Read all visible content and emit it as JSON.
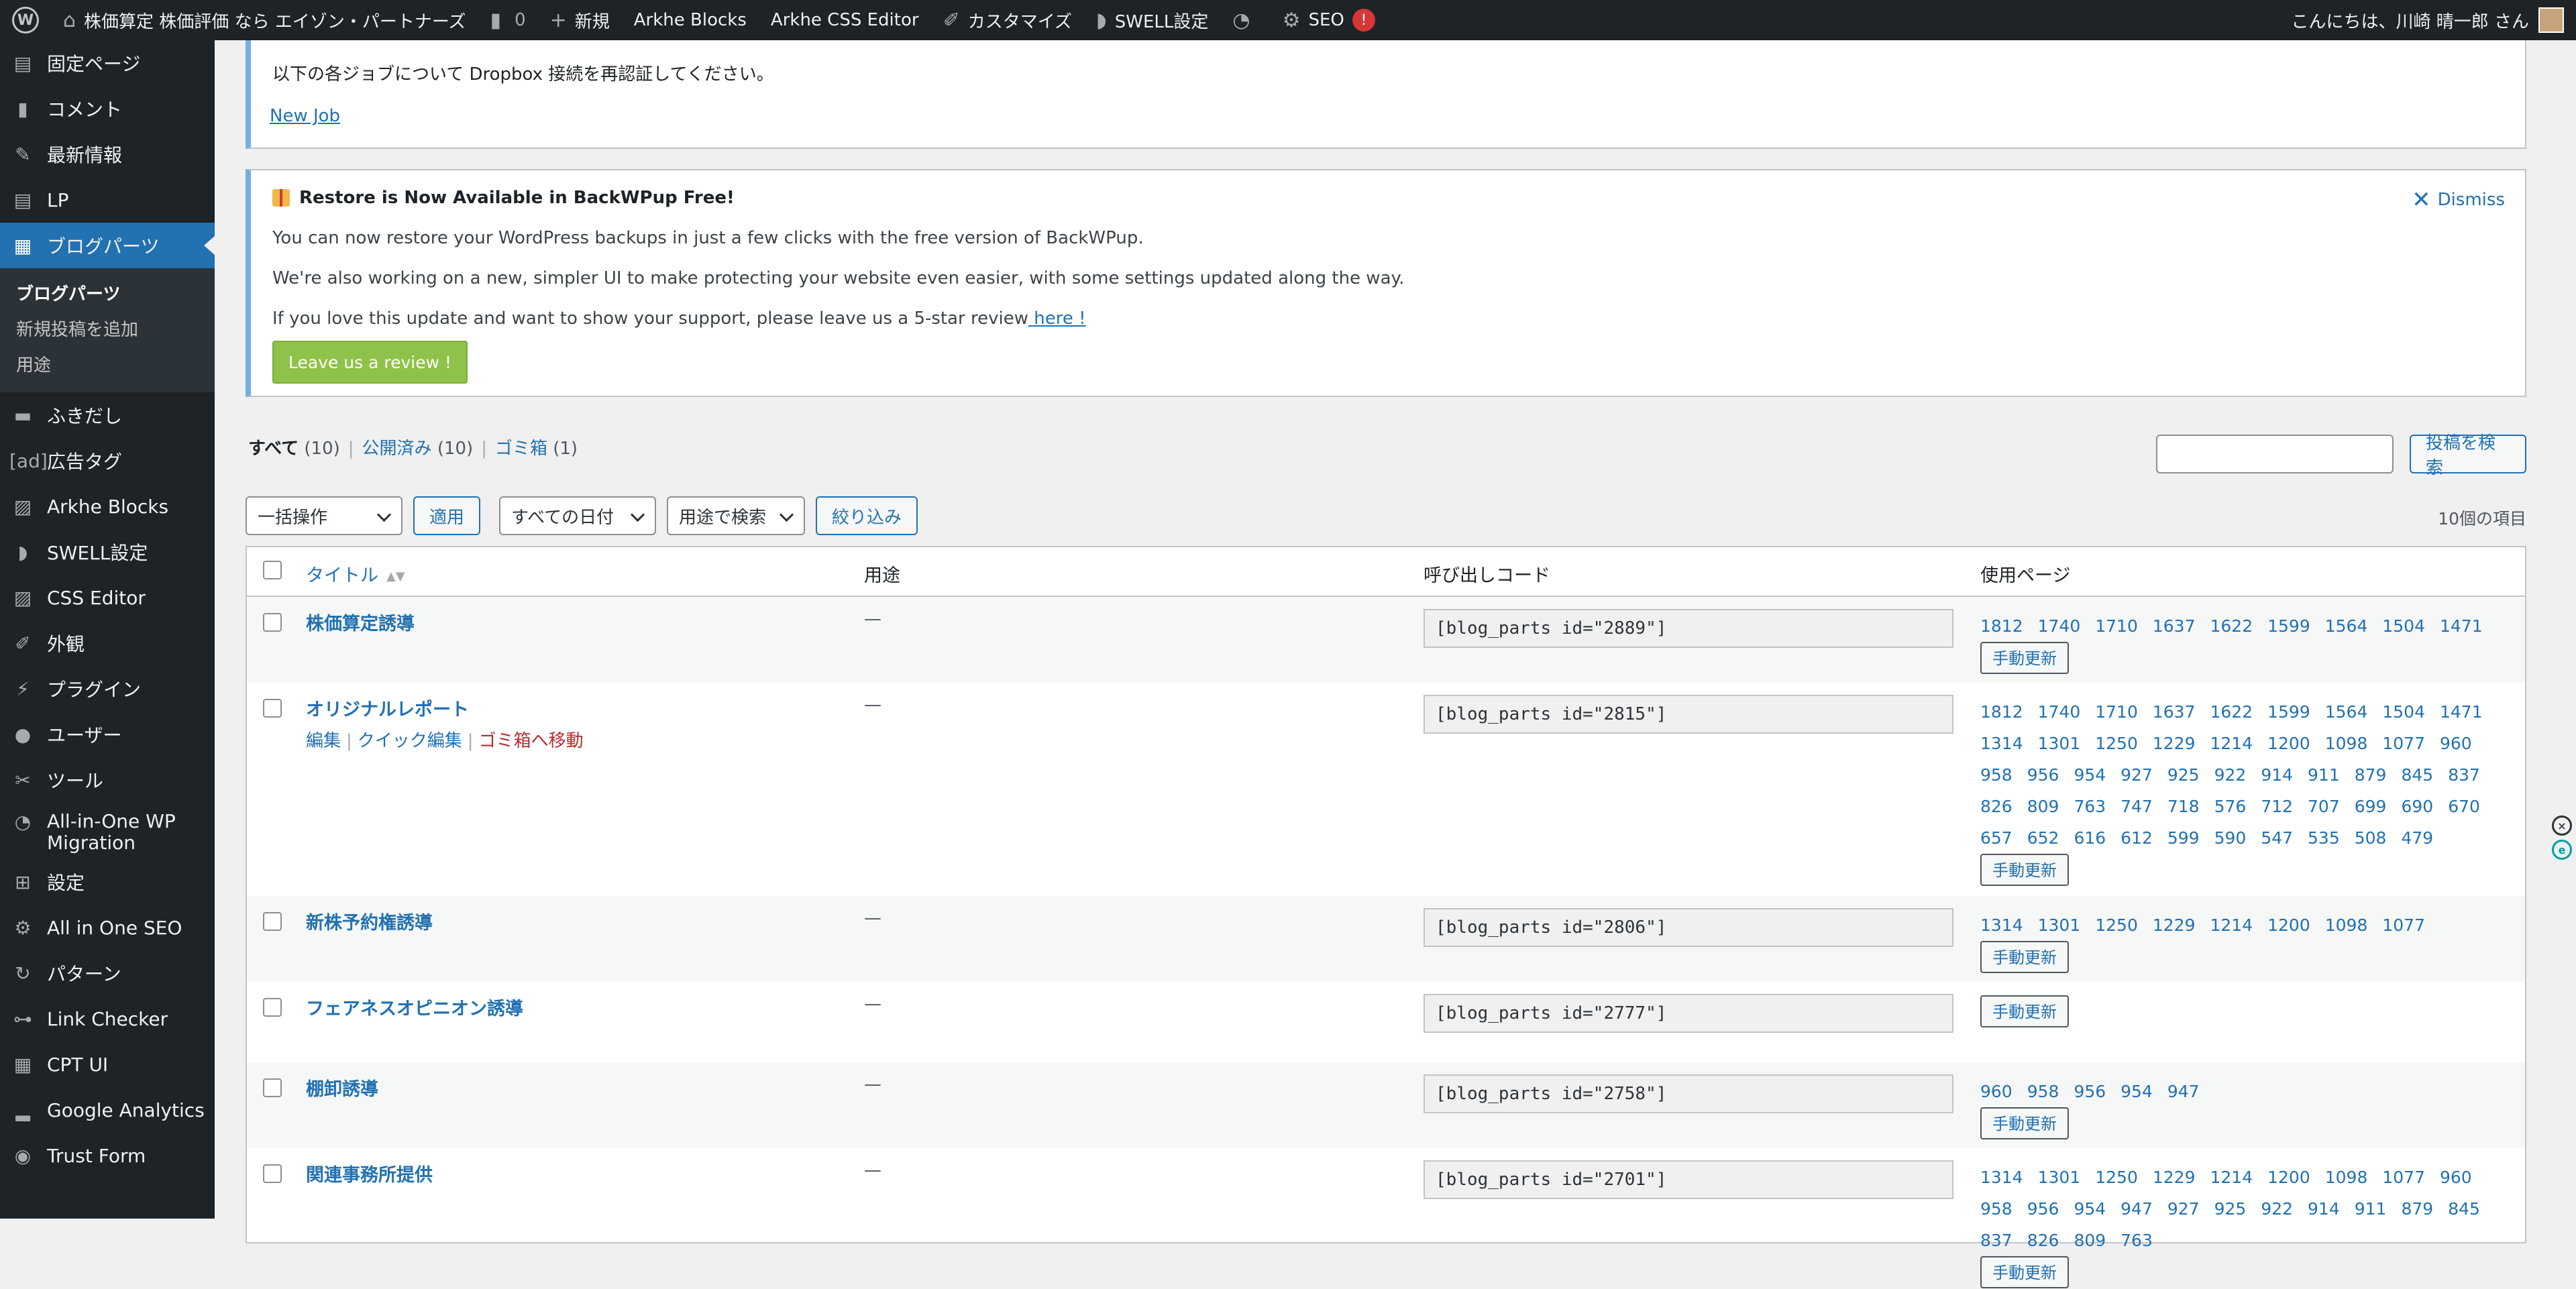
{
  "adminbar": {
    "site_name": "株価算定 株価評価 なら エイゾン・パートナーズ",
    "comments_count": "0",
    "new_label": "新規",
    "arkhe_blocks": "Arkhe Blocks",
    "arkhe_css": "Arkhe CSS Editor",
    "customize": "カスタマイズ",
    "swell": "SWELL設定",
    "seo": "SEO",
    "seo_badge": "!",
    "greeting": "こんにちは、川崎 晴一郎 さん"
  },
  "sidebar": {
    "items_top": [
      {
        "icon": "page-icon",
        "glyph": "▤",
        "label": "固定ページ"
      },
      {
        "icon": "comment-icon",
        "glyph": "▮",
        "label": "コメント"
      },
      {
        "icon": "pin-icon",
        "glyph": "✎",
        "label": "最新情報"
      },
      {
        "icon": "page-icon",
        "glyph": "▤",
        "label": "LP"
      }
    ],
    "current": {
      "icon": "layout-icon",
      "glyph": "▦",
      "label": "ブログパーツ"
    },
    "submenu": [
      "ブログパーツ",
      "新規投稿を追加",
      "用途"
    ],
    "items_bottom": [
      {
        "icon": "balloon-icon",
        "glyph": "▬",
        "label": "ふきだし"
      },
      {
        "icon": "ad-icon",
        "glyph": "[ad]",
        "label": "広告タグ"
      },
      {
        "icon": "arkhe-icon",
        "glyph": "▨",
        "label": "Arkhe Blocks"
      },
      {
        "icon": "swell-icon",
        "glyph": "◗",
        "label": "SWELL設定"
      },
      {
        "icon": "css-icon",
        "glyph": "▨",
        "label": "CSS Editor"
      },
      {
        "icon": "brush-icon",
        "glyph": "✐",
        "label": "外観"
      },
      {
        "icon": "plugin-icon",
        "glyph": "⚡",
        "label": "プラグイン"
      },
      {
        "icon": "user-icon",
        "glyph": "●",
        "label": "ユーザー"
      },
      {
        "icon": "wrench-icon",
        "glyph": "✂",
        "label": "ツール"
      }
    ],
    "migration": {
      "icon": "migration-icon",
      "glyph": "◔",
      "label_1": "All-in-One WP",
      "label_2": "Migration"
    },
    "items_last": [
      {
        "icon": "settings-icon",
        "glyph": "⊞",
        "label": "設定"
      },
      {
        "icon": "seo-icon",
        "glyph": "⚙",
        "label": "All in One SEO"
      },
      {
        "icon": "pattern-icon",
        "glyph": "↻",
        "label": "パターン"
      },
      {
        "icon": "link-icon",
        "glyph": "⊶",
        "label": "Link Checker"
      },
      {
        "icon": "cptui-icon",
        "glyph": "▦",
        "label": "CPT UI"
      },
      {
        "icon": "analytics-icon",
        "glyph": "▂",
        "label": "Google Analytics"
      },
      {
        "icon": "form-icon",
        "glyph": "◉",
        "label": "Trust Form"
      }
    ]
  },
  "notice1": {
    "text": "以下の各ジョブについて Dropbox 接続を再認証してください。",
    "link": "New Job"
  },
  "notice2": {
    "title": "Restore is Now Available in BackWPup Free!",
    "dismiss": "Dismiss",
    "line1": "You can now restore your WordPress backups in just a few clicks with the free version of BackWPup.",
    "line2": "We're also working on a new, simpler UI to make protecting your website even easier, with some settings updated along the way.",
    "line3": "If you love this update and want to show your support, please leave us a 5-star review",
    "line3_link": " here !",
    "button": "Leave us a review !"
  },
  "filters": {
    "all": "すべて",
    "all_count": "(10)",
    "published": "公開済み",
    "published_count": "(10)",
    "trash": "ゴミ箱",
    "trash_count": "(1)",
    "search_button": "投稿を検索"
  },
  "toolbar": {
    "bulk": "一括操作",
    "apply": "適用",
    "dates": "すべての日付",
    "usage": "用途で検索",
    "filter": "絞り込み",
    "count": "10個の項目"
  },
  "table": {
    "headers": {
      "title": "タイトル",
      "usage": "用途",
      "code": "呼び出しコード",
      "pages": "使用ページ"
    },
    "update_label": "手動更新",
    "row_actions": {
      "edit": "編集",
      "quick": "クイック編集",
      "trash": "ゴミ箱へ移動"
    },
    "rows": [
      {
        "title": "株価算定誘導",
        "usage": "—",
        "code": "[blog_parts id=\"2889\"]",
        "pages": [
          "1812",
          "1740",
          "1710",
          "1637",
          "1622",
          "1599",
          "1564",
          "1504",
          "1471"
        ]
      },
      {
        "title": "オリジナルレポート",
        "usage": "—",
        "code": "[blog_parts id=\"2815\"]",
        "pages": [
          "1812",
          "1740",
          "1710",
          "1637",
          "1622",
          "1599",
          "1564",
          "1504",
          "1471",
          "1314",
          "1301",
          "1250",
          "1229",
          "1214",
          "1200",
          "1098",
          "1077",
          "960",
          "958",
          "956",
          "954",
          "927",
          "925",
          "922",
          "914",
          "911",
          "879",
          "845",
          "837",
          "826",
          "809",
          "763",
          "747",
          "718",
          "576",
          "712",
          "707",
          "699",
          "690",
          "670",
          "657",
          "652",
          "616",
          "612",
          "599",
          "590",
          "547",
          "535",
          "508",
          "479"
        ]
      },
      {
        "title": "新株予約権誘導",
        "usage": "—",
        "code": "[blog_parts id=\"2806\"]",
        "pages": [
          "1314",
          "1301",
          "1250",
          "1229",
          "1214",
          "1200",
          "1098",
          "1077"
        ]
      },
      {
        "title": "フェアネスオピニオン誘導",
        "usage": "—",
        "code": "[blog_parts id=\"2777\"]",
        "pages": []
      },
      {
        "title": "棚卸誘導",
        "usage": "—",
        "code": "[blog_parts id=\"2758\"]",
        "pages": [
          "960",
          "958",
          "956",
          "954",
          "947"
        ]
      },
      {
        "title": "関連事務所提供",
        "usage": "—",
        "code": "[blog_parts id=\"2701\"]",
        "pages": [
          "1314",
          "1301",
          "1250",
          "1229",
          "1214",
          "1200",
          "1098",
          "1077",
          "960",
          "958",
          "956",
          "954",
          "947",
          "927",
          "925",
          "922",
          "914",
          "911",
          "879",
          "845",
          "837",
          "826",
          "809",
          "763"
        ]
      }
    ]
  }
}
